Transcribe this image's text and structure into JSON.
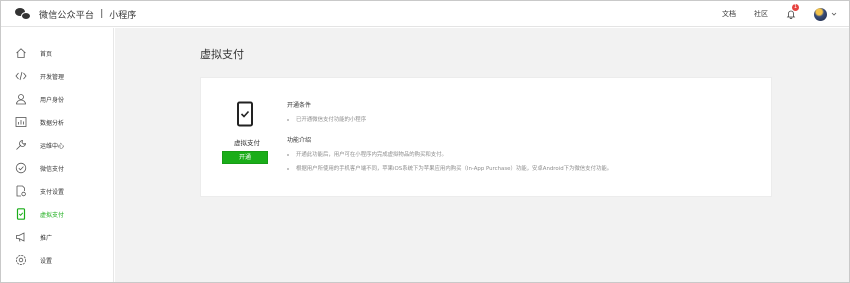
{
  "header": {
    "platform_name": "微信公众平台",
    "separator": "|",
    "product_name": "小程序",
    "links": [
      "文档",
      "社区"
    ],
    "notification_count": "1"
  },
  "sidebar": {
    "items": [
      {
        "label": "首页",
        "icon": "home-icon"
      },
      {
        "label": "开发管理",
        "icon": "code-icon"
      },
      {
        "label": "用户身份",
        "icon": "user-icon"
      },
      {
        "label": "数据分析",
        "icon": "chart-icon"
      },
      {
        "label": "运维中心",
        "icon": "wrench-icon"
      },
      {
        "label": "微信支付",
        "icon": "gauge-icon"
      },
      {
        "label": "支付设置",
        "icon": "document-settings-icon"
      },
      {
        "label": "虚拟支付",
        "icon": "phone-check-icon",
        "active": true
      },
      {
        "label": "推广",
        "icon": "megaphone-icon"
      },
      {
        "label": "设置",
        "icon": "settings-icon"
      }
    ],
    "active_color": "#1aad19"
  },
  "main": {
    "page_title": "虚拟支付",
    "card": {
      "product_name": "虚拟支付",
      "enable_button": "开通",
      "conditions_title": "开通条件",
      "conditions": [
        "已开通微信支付功能的小程序"
      ],
      "intro_title": "功能介绍",
      "intro": [
        "开通此功能后，用户可在小程序内完成虚拟物品的购买和支付。",
        "根据用户所使用的手机客户端不同，苹果iOS系统下为苹果应用内购买（In-App Purchase）功能，安卓Android下为微信支付功能。"
      ]
    }
  },
  "colors": {
    "brand_green": "#1aad19",
    "badge_red": "#e64340",
    "background": "#f2f2f2"
  }
}
